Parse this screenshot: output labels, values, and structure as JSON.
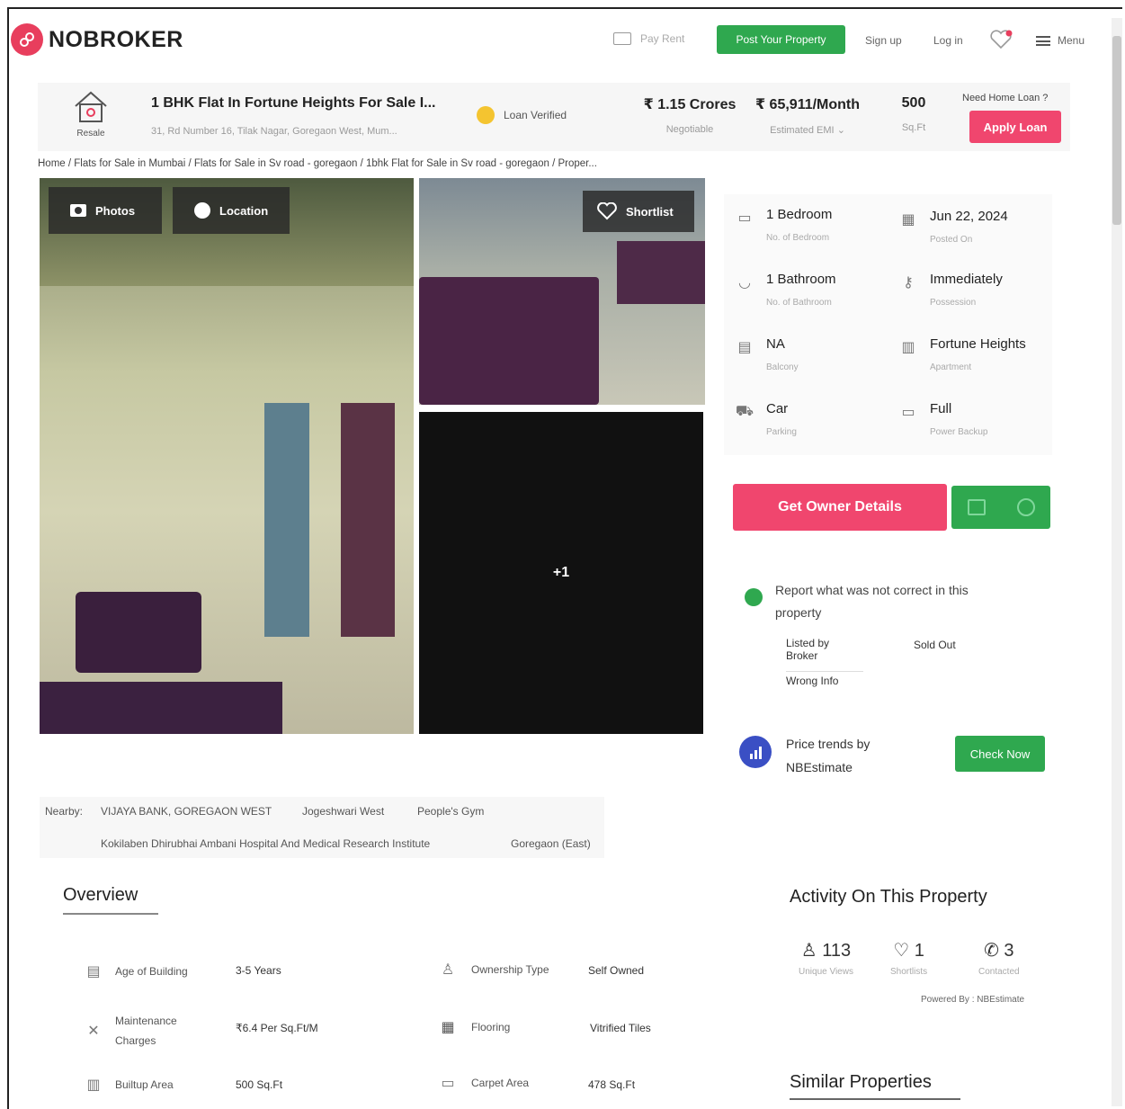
{
  "header": {
    "logo_text": "NOBROKER",
    "pay_rent": "Pay Rent",
    "post_property": "Post Your Property",
    "sign_up": "Sign up",
    "log_in": "Log in",
    "menu": "Menu"
  },
  "property": {
    "type_label": "Resale",
    "title": "1 BHK Flat In Fortune Heights For Sale I...",
    "address": "31, Rd Number 16, Tilak Nagar, Goregaon West, Mum...",
    "loan_verified": "Loan Verified",
    "price": "₹ 1.15 Crores",
    "price_sub": "Negotiable",
    "emi": "₹ 65,911/Month",
    "emi_sub": "Estimated EMI",
    "area": "500",
    "area_sub": "Sq.Ft",
    "need_loan": "Need Home Loan ?",
    "apply_loan": "Apply Loan"
  },
  "breadcrumb": "Home / Flats for Sale in Mumbai / Flats for Sale in Sv road - goregaon / 1bhk Flat for Sale in Sv road - goregaon / Proper...",
  "gallery": {
    "photos_btn": "Photos",
    "location_btn": "Location",
    "shortlist_btn": "Shortlist",
    "more_count": "+1"
  },
  "details": [
    {
      "value": "1 Bedroom",
      "sub": "No. of Bedroom",
      "icon": "bed-icon"
    },
    {
      "value": "Jun 22, 2024",
      "sub": "Posted On",
      "icon": "calendar-icon"
    },
    {
      "value": "1 Bathroom",
      "sub": "No. of Bathroom",
      "icon": "bath-icon"
    },
    {
      "value": "Immediately",
      "sub": "Possession",
      "icon": "key-icon"
    },
    {
      "value": "NA",
      "sub": "Balcony",
      "icon": "balcony-icon"
    },
    {
      "value": "Fortune Heights",
      "sub": "Apartment",
      "icon": "building-icon"
    },
    {
      "value": "Car",
      "sub": "Parking",
      "icon": "car-icon"
    },
    {
      "value": "Full",
      "sub": "Power Backup",
      "icon": "battery-icon"
    }
  ],
  "actions": {
    "get_owner": "Get Owner Details"
  },
  "report": {
    "text": "Report what was not correct in this property",
    "options": [
      "Listed by Broker",
      "Sold Out",
      "Wrong Info"
    ]
  },
  "price_trends": {
    "text": "Price trends by NBEstimate",
    "button": "Check Now"
  },
  "nearby": {
    "label": "Nearby:",
    "items": [
      "VIJAYA BANK, GOREGAON WEST",
      "Jogeshwari West",
      "People's Gym",
      "Kokilaben Dhirubhai Ambani Hospital And Medical Research Institute",
      "Goregaon (East)"
    ]
  },
  "overview": {
    "title": "Overview",
    "rows": [
      {
        "label": "Age of Building",
        "value": "3-5 Years"
      },
      {
        "label": "Ownership Type",
        "value": "Self Owned"
      },
      {
        "label": "Maintenance Charges",
        "value": "₹6.4 Per Sq.Ft/M"
      },
      {
        "label": "Flooring",
        "value": "Vitrified Tiles"
      },
      {
        "label": "Builtup Area",
        "value": "500 Sq.Ft"
      },
      {
        "label": "Carpet Area",
        "value": "478 Sq.Ft"
      }
    ]
  },
  "activity": {
    "title": "Activity On This Property",
    "views": "113",
    "views_sub": "Unique Views",
    "shortlists": "1",
    "shortlists_sub": "Shortlists",
    "contacted": "3",
    "contacted_sub": "Contacted",
    "powered": "Powered By : NBEstimate"
  },
  "similar": {
    "title": "Similar Properties"
  },
  "colors": {
    "brand": "#e83e5d",
    "green": "#2fa84f",
    "pink": "#f0466e"
  }
}
